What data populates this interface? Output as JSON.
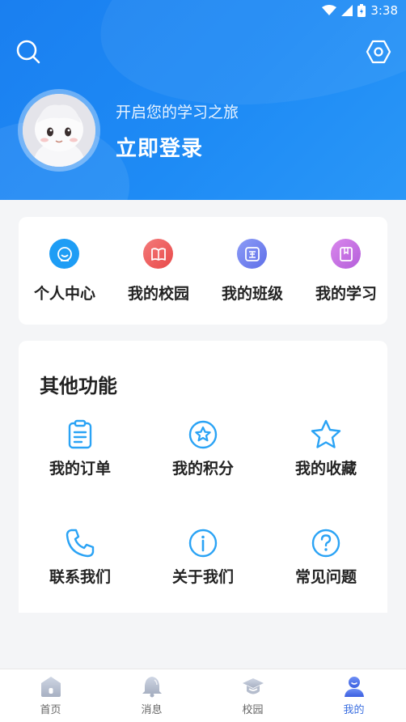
{
  "status_bar": {
    "time": "3:38"
  },
  "header": {
    "subtitle": "开启您的学习之旅",
    "login_label": "立即登录"
  },
  "quick_menu": [
    {
      "label": "个人中心",
      "icon": "smile-icon",
      "color": "#1e9df5"
    },
    {
      "label": "我的校园",
      "icon": "book-open-icon",
      "color": "#f05a5a"
    },
    {
      "label": "我的班级",
      "icon": "class-icon",
      "color": "#6b7ef0"
    },
    {
      "label": "我的学习",
      "icon": "notebook-icon",
      "color": "#c36be0"
    }
  ],
  "other_functions": {
    "title": "其他功能",
    "items": [
      {
        "label": "我的订单",
        "icon": "clipboard-icon"
      },
      {
        "label": "我的积分",
        "icon": "star-badge-icon"
      },
      {
        "label": "我的收藏",
        "icon": "star-icon"
      },
      {
        "label": "联系我们",
        "icon": "phone-icon"
      },
      {
        "label": "关于我们",
        "icon": "info-icon"
      },
      {
        "label": "常见问题",
        "icon": "question-icon"
      }
    ]
  },
  "tab_bar": [
    {
      "label": "首页",
      "icon": "home-icon",
      "active": false
    },
    {
      "label": "消息",
      "icon": "bell-icon",
      "active": false
    },
    {
      "label": "校园",
      "icon": "graduation-cap-icon",
      "active": false
    },
    {
      "label": "我的",
      "icon": "user-icon",
      "active": true
    }
  ],
  "colors": {
    "primary": "#1e88f5",
    "icon_blue": "#2aa3f5",
    "tab_active": "#3b6fe0"
  }
}
